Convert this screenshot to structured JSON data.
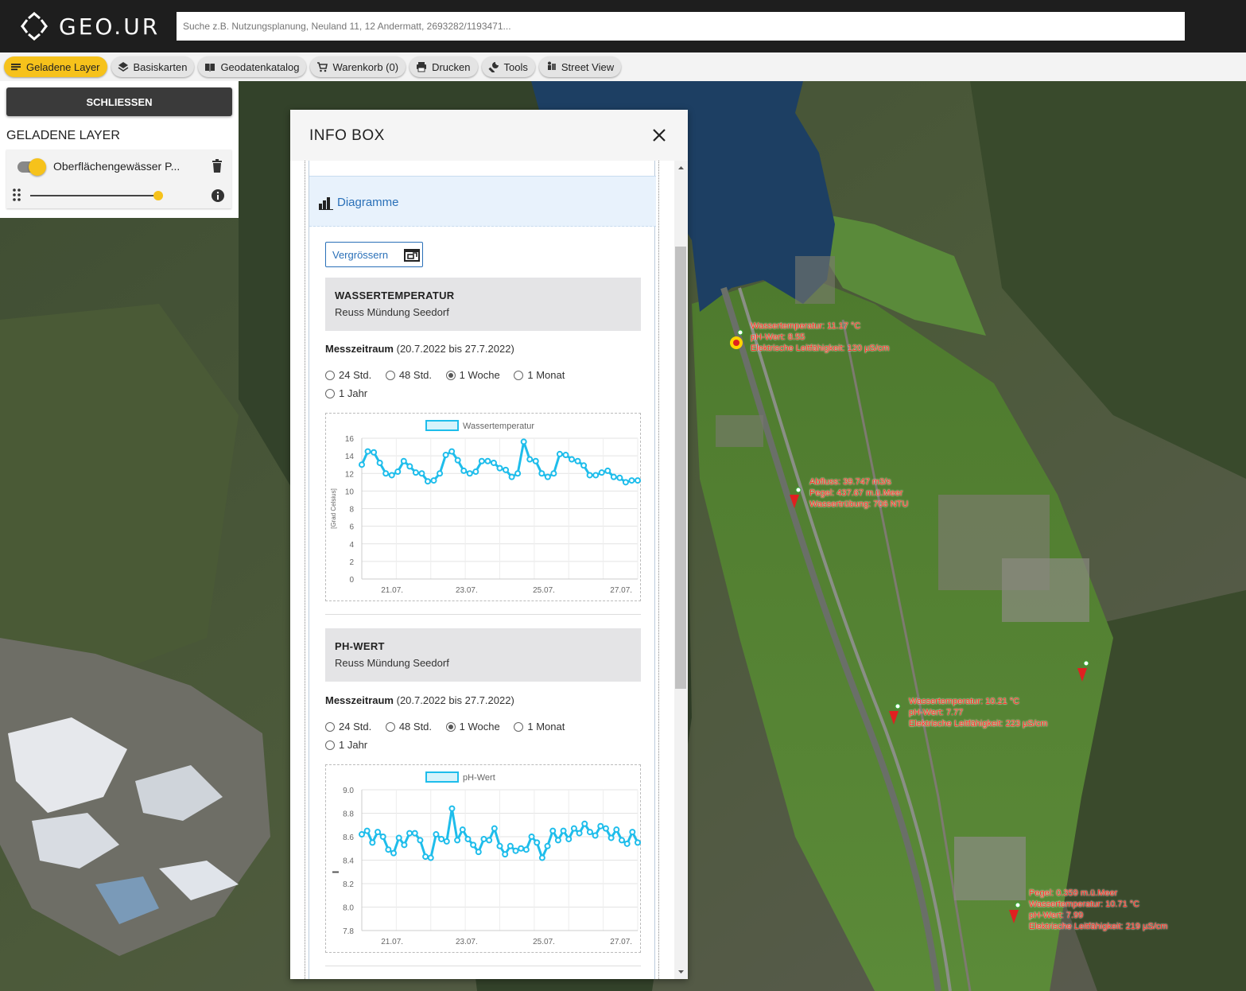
{
  "header": {
    "logo_text": "GEO.UR",
    "search_placeholder": "Suche z.B. Nutzungsplanung, Neuland 11, 12 Andermatt, 2693282/1193471..."
  },
  "toolbar": {
    "items": [
      {
        "label": "Geladene Layer",
        "icon": "layers-list-icon"
      },
      {
        "label": "Basiskarten",
        "icon": "stack-icon"
      },
      {
        "label": "Geodatenkatalog",
        "icon": "book-icon"
      },
      {
        "label": "Warenkorb (0)",
        "icon": "cart-icon"
      },
      {
        "label": "Drucken",
        "icon": "printer-icon"
      },
      {
        "label": "Tools",
        "icon": "wrench-icon"
      },
      {
        "label": "Street View",
        "icon": "street-view-icon"
      }
    ]
  },
  "layer_panel": {
    "close_label": "SCHLIESSEN",
    "title": "GELADENE LAYER",
    "layer_name": "Oberflächengewässer P...",
    "layer_enabled": true,
    "opacity": 1.0
  },
  "map_markers": [
    {
      "lines": [
        "Wassertemperatur: 11.17 °C",
        "pH-Wert: 8.55",
        "Elektrische Leitfähigkeit: 120 µS/cm"
      ],
      "selected": true
    },
    {
      "lines": [
        "Abfluss: 39.747 m3/s",
        "Pegel: 437.67 m.ü.Meer",
        "Wassertrübung: 706 NTU"
      ],
      "selected": false
    },
    {
      "lines": [
        "Wassertemperatur: 10.21 °C",
        "pH-Wert: 7.77",
        "Elektrische Leitfähigkeit: 223 µS/cm"
      ],
      "selected": false
    },
    {
      "lines": [],
      "selected": false
    },
    {
      "lines": [
        "Pegel: 0.359 m.ü.Meer",
        "Wassertemperatur: 10.71 °C",
        "pH-Wert: 7.99",
        "Elektrische Leitfähigkeit: 219 µS/cm"
      ],
      "selected": false
    }
  ],
  "infobox": {
    "title": "INFO BOX",
    "tab_label": "Diagramme",
    "enlarge_label": "Vergrössern",
    "sections": [
      {
        "title": "WASSERTEMPERATUR",
        "subtitle": "Reuss Mündung Seedorf",
        "period_label": "Messzeitraum",
        "period_range": "(20.7.2022 bis 27.7.2022)",
        "options": [
          "24 Std.",
          "48 Std.",
          "1 Woche",
          "1 Monat",
          "1 Jahr"
        ],
        "selected_option": "1 Woche"
      },
      {
        "title": "PH-WERT",
        "subtitle": "Reuss Mündung Seedorf",
        "period_label": "Messzeitraum",
        "period_range": "(20.7.2022 bis 27.7.2022)",
        "options": [
          "24 Std.",
          "48 Std.",
          "1 Woche",
          "1 Monat",
          "1 Jahr"
        ],
        "selected_option": "1 Woche"
      }
    ]
  },
  "chart_data": [
    {
      "type": "line",
      "title": "",
      "series": [
        {
          "name": "Wassertemperatur",
          "values": [
            13.0,
            14.5,
            14.4,
            13.2,
            12.0,
            11.8,
            12.2,
            13.4,
            12.8,
            12.1,
            12.0,
            11.1,
            11.2,
            12.0,
            14.1,
            14.5,
            13.5,
            12.3,
            12.0,
            12.2,
            13.4,
            13.4,
            13.2,
            12.6,
            12.4,
            11.6,
            12.0,
            15.6,
            13.6,
            13.4,
            12.0,
            11.6,
            12.0,
            14.2,
            14.1,
            13.6,
            13.4,
            12.9,
            11.8,
            11.8,
            12.1,
            12.3,
            11.6,
            11.5,
            11.0,
            11.2,
            11.2
          ]
        }
      ],
      "x_ticks": [
        "21.07.",
        "23.07.",
        "25.07.",
        "27.07."
      ],
      "xlabel": "",
      "ylabel": "[Grad Celsius]",
      "ylim": [
        0,
        16
      ],
      "y_ticks": [
        0,
        2,
        4,
        6,
        8,
        10,
        12,
        14,
        16
      ],
      "color": "#1ebdeb",
      "grid": true,
      "legend": "top"
    },
    {
      "type": "line",
      "title": "",
      "series": [
        {
          "name": "pH-Wert",
          "values": [
            8.62,
            8.65,
            8.55,
            8.64,
            8.6,
            8.49,
            8.46,
            8.59,
            8.53,
            8.63,
            8.63,
            8.57,
            8.43,
            8.42,
            8.62,
            8.58,
            8.56,
            8.84,
            8.57,
            8.66,
            8.58,
            8.53,
            8.47,
            8.58,
            8.57,
            8.67,
            8.52,
            8.45,
            8.52,
            8.48,
            8.5,
            8.49,
            8.6,
            8.55,
            8.42,
            8.52,
            8.65,
            8.57,
            8.65,
            8.58,
            8.67,
            8.63,
            8.71,
            8.64,
            8.61,
            8.69,
            8.67,
            8.59,
            8.66,
            8.57,
            8.54,
            8.64,
            8.55
          ]
        }
      ],
      "x_ticks": [
        "21.07.",
        "23.07.",
        "25.07.",
        "27.07."
      ],
      "xlabel": "",
      "ylabel": "",
      "ylim": [
        7.8,
        9.0
      ],
      "y_ticks": [
        7.8,
        8.0,
        8.2,
        8.4,
        8.6,
        8.8,
        9.0
      ],
      "color": "#1ebdeb",
      "grid": true,
      "legend": "top"
    }
  ]
}
